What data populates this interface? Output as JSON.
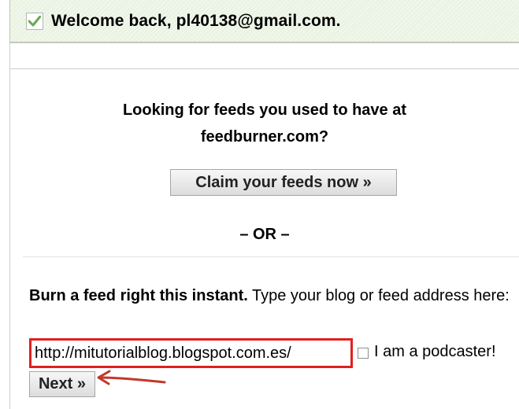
{
  "welcome": {
    "text": "Welcome back, pl40138@gmail.com."
  },
  "claim": {
    "heading_line1": "Looking for feeds you used to have at",
    "heading_line2": "feedburner.com?",
    "button_label": "Claim your feeds now »"
  },
  "or_text": "– OR –",
  "burn": {
    "bold_text": "Burn a feed right this instant.",
    "rest_text": " Type your blog or feed address here:",
    "url_value": "http://mitutorialblog.blogspot.com.es/",
    "podcaster_label": "I am a podcaster!",
    "next_label": "Next »"
  },
  "colors": {
    "highlight": "#e02020",
    "arrow": "#c0392b",
    "checkmark": "#6aa84f"
  },
  "icons": {
    "check": "checkmark-icon",
    "annotation": "arrow-icon"
  }
}
